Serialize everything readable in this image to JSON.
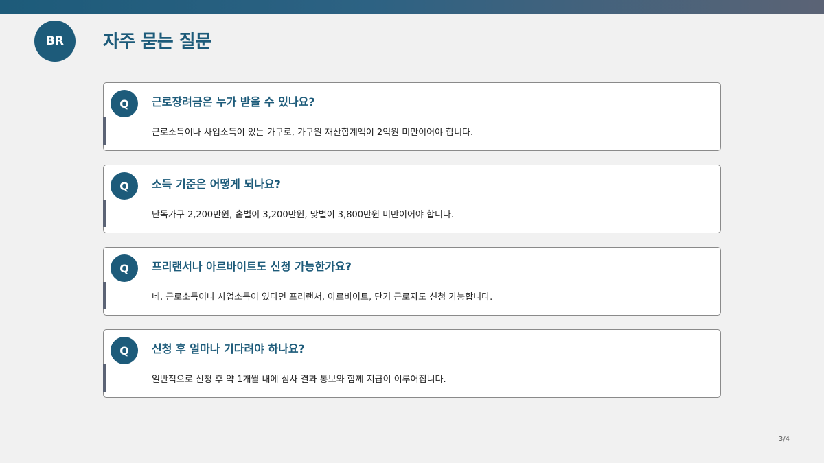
{
  "header": {
    "logo_text": "BR",
    "title": "자주 묻는 질문"
  },
  "colors": {
    "primary": "#1d5b7a",
    "accent_bar": "#5b6375",
    "background": "#f1f1f1"
  },
  "faq": [
    {
      "badge": "Q",
      "question": "근로장려금은 누가 받을 수 있나요?",
      "answer": "근로소득이나 사업소득이 있는 가구로, 가구원 재산합계액이 2억원 미만이어야 합니다."
    },
    {
      "badge": "Q",
      "question": "소득 기준은 어떻게 되나요?",
      "answer": "단독가구 2,200만원, 홑벌이 3,200만원, 맞벌이 3,800만원 미만이어야 합니다."
    },
    {
      "badge": "Q",
      "question": "프리랜서나 아르바이트도 신청 가능한가요?",
      "answer": "네, 근로소득이나 사업소득이 있다면 프리랜서, 아르바이트, 단기 근로자도 신청 가능합니다."
    },
    {
      "badge": "Q",
      "question": "신청 후 얼마나 기다려야 하나요?",
      "answer": "일반적으로 신청 후 약 1개월 내에 심사 결과 통보와 함께 지급이 이루어집니다."
    }
  ],
  "footer": {
    "page_number": "3/4"
  }
}
